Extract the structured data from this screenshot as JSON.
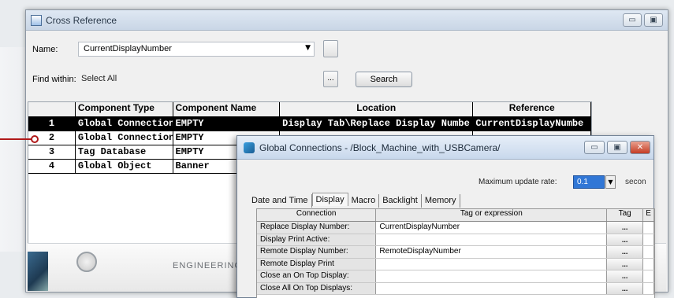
{
  "xref": {
    "title": "Cross Reference",
    "name_label": "Name:",
    "name_value": "CurrentDisplayNumber",
    "find_label": "Find within:",
    "find_value": "Select All",
    "find_dots": "...",
    "search_label": "Search",
    "columns": [
      "",
      "Component Type",
      "Component Name",
      "Location",
      "Reference"
    ],
    "rows": [
      {
        "n": "1",
        "type": "Global Connection",
        "name": "EMPTY",
        "loc": "Display Tab\\Replace Display Numbe",
        "ref": "CurrentDisplayNumbe"
      },
      {
        "n": "2",
        "type": "Global Connection",
        "name": "EMPTY",
        "loc": "",
        "ref": ""
      },
      {
        "n": "3",
        "type": "Tag Database",
        "name": "EMPTY",
        "loc": "",
        "ref": ""
      },
      {
        "n": "4",
        "type": "Global Object",
        "name": "Banner",
        "loc": "",
        "ref": ""
      }
    ],
    "footer_text": "ENGINEERING"
  },
  "gc": {
    "title": "Global Connections - /Block_Machine_with_USBCamera/",
    "rate_label": "Maximum update rate:",
    "rate_value": "0.1",
    "rate_unit": "secon",
    "tabs": [
      "Date and Time",
      "Display",
      "Macro",
      "Backlight",
      "Memory"
    ],
    "columns": [
      "Connection",
      "Tag or expression",
      "Tag",
      "E"
    ],
    "rows": [
      {
        "conn": "Replace Display Number:",
        "expr": "CurrentDisplayNumber",
        "tag": "..."
      },
      {
        "conn": "Display Print Active:",
        "expr": "",
        "tag": "..."
      },
      {
        "conn": "Remote Display Number:",
        "expr": "RemoteDisplayNumber",
        "tag": "..."
      },
      {
        "conn": "Remote Display Print",
        "expr": "",
        "tag": "..."
      },
      {
        "conn": "Close an On Top Display:",
        "expr": "",
        "tag": "..."
      },
      {
        "conn": "Close All On Top Displays:",
        "expr": "",
        "tag": "..."
      }
    ]
  }
}
